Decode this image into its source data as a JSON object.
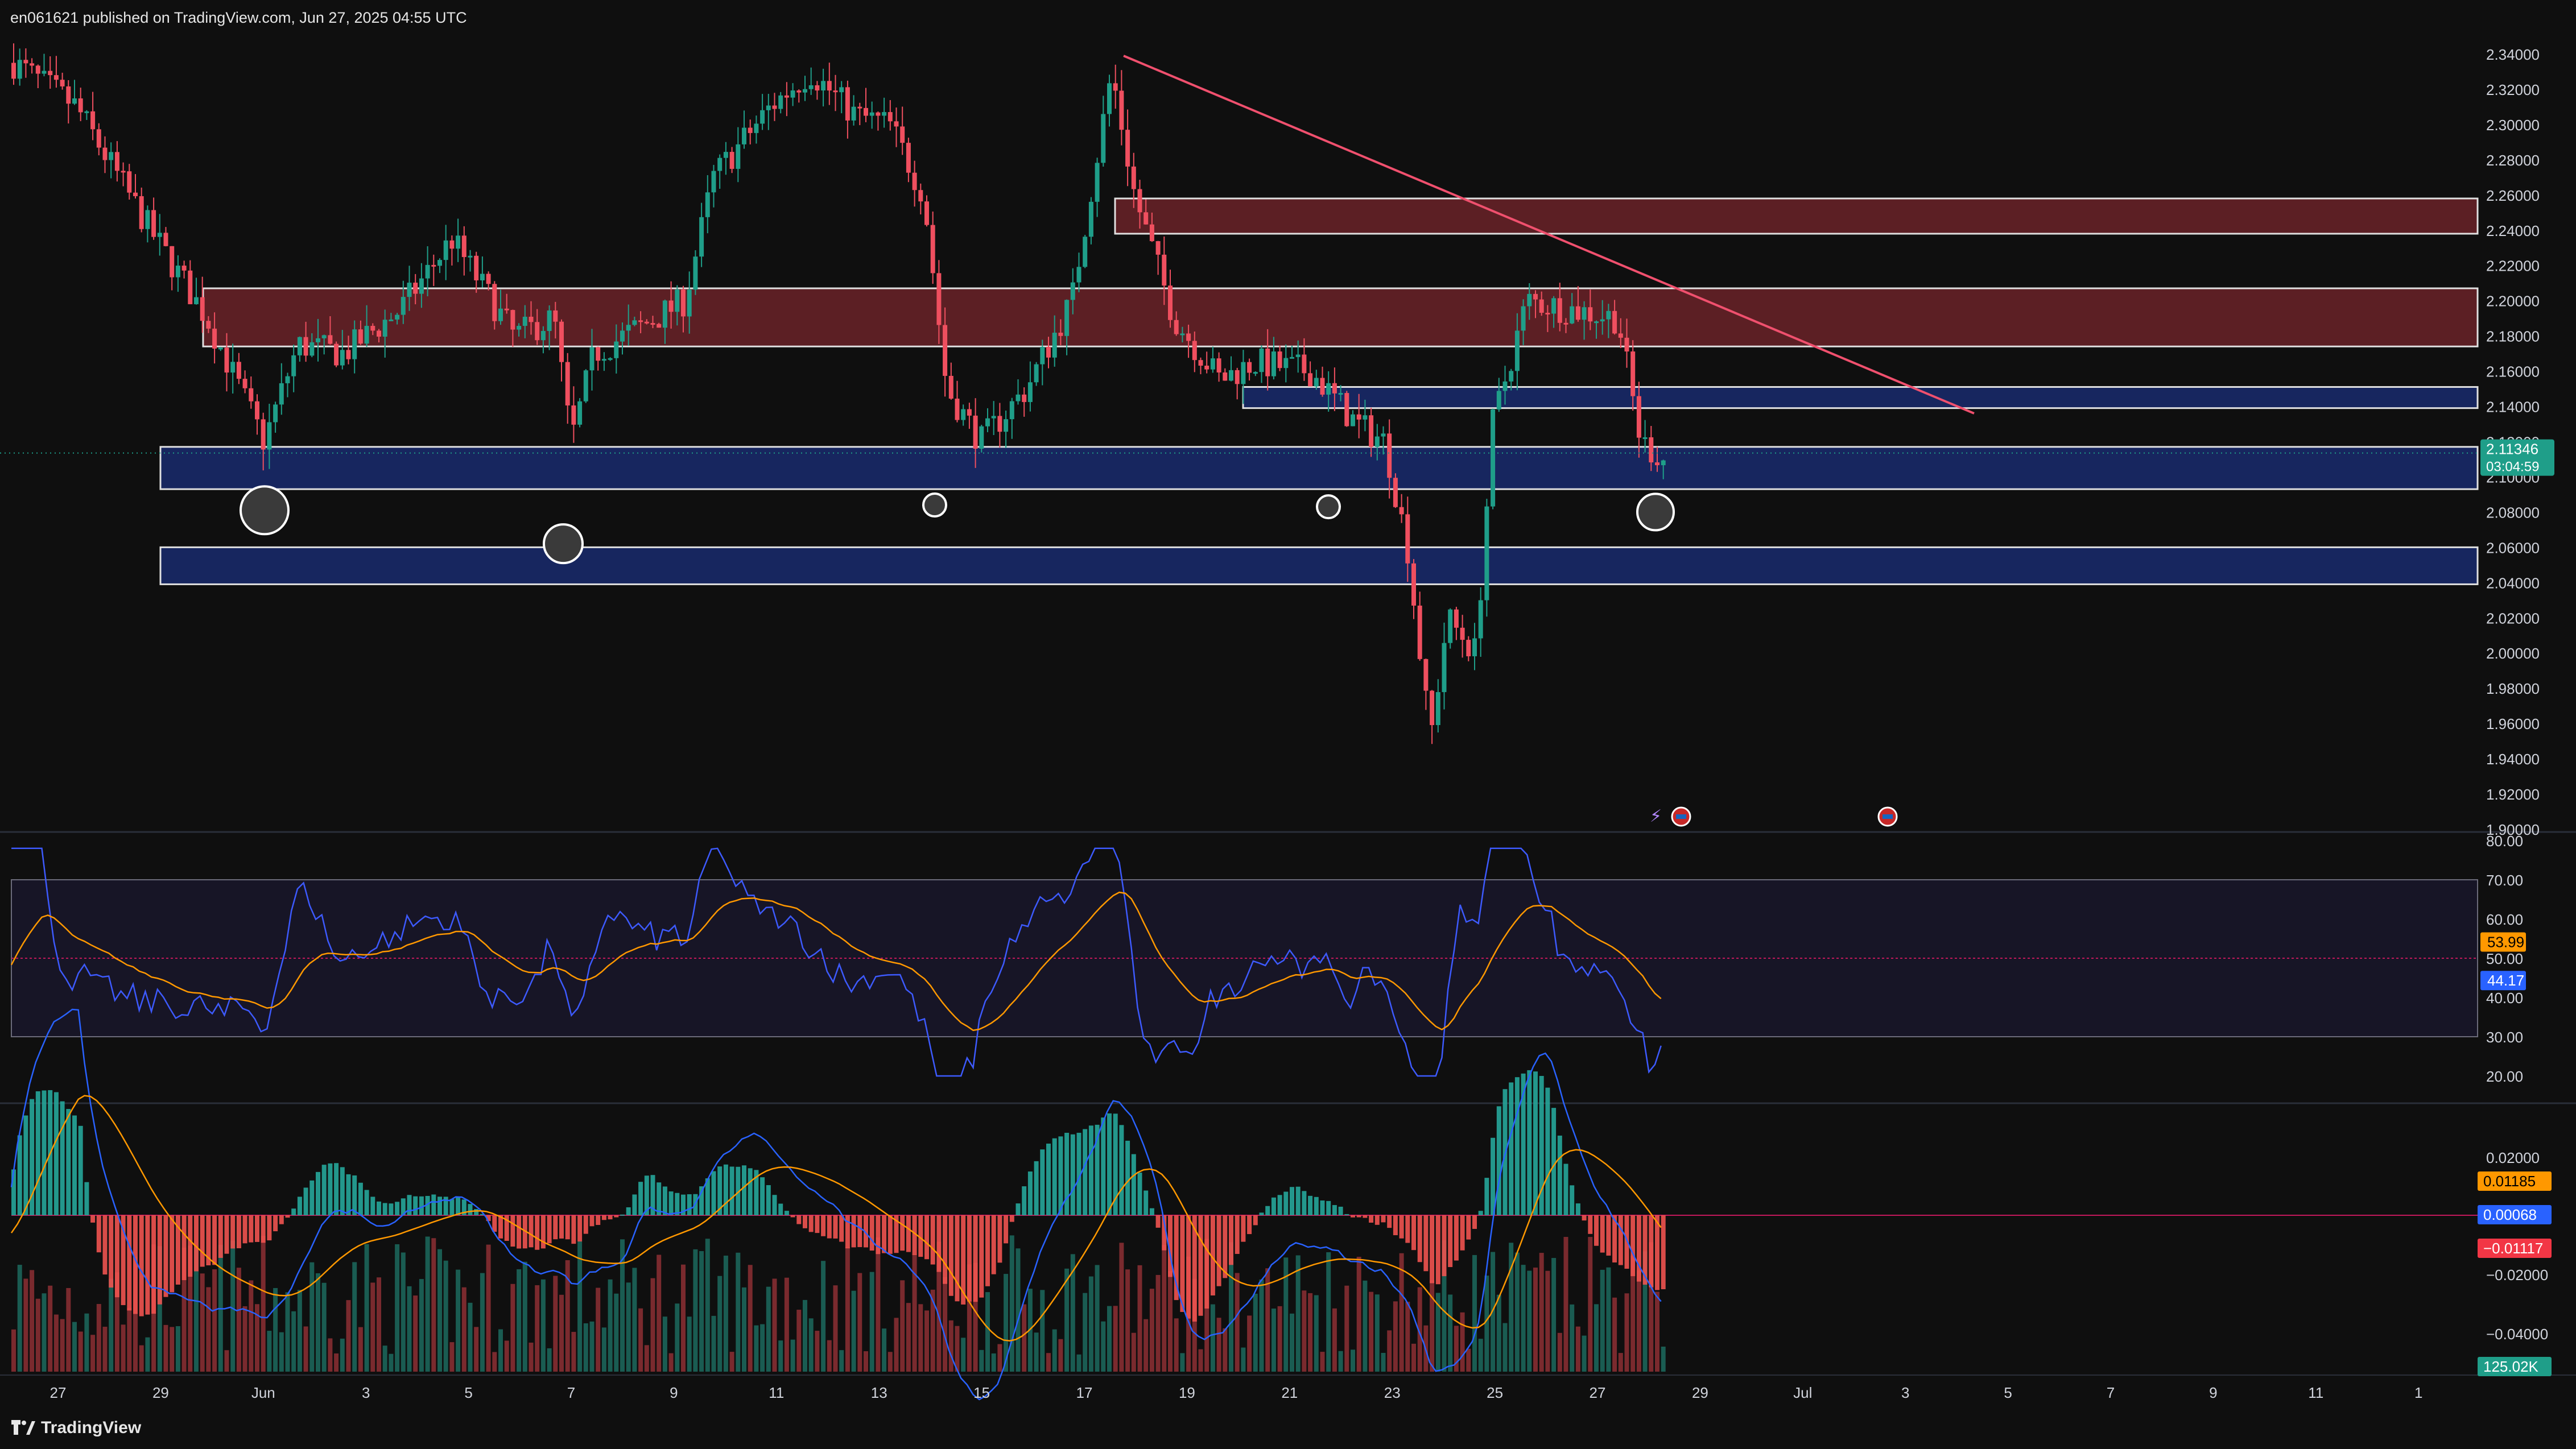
{
  "header": {
    "published_text": "en061621 published on TradingView.com, Jun 27, 2025 04:55 UTC"
  },
  "footer": {
    "brand": "TradingView"
  },
  "icons": [
    "tradingview-logo-icon",
    "flash-icon",
    "us-flag-event-icon"
  ],
  "colors": {
    "background": "#0f0f0f",
    "up_candle": "#1f9e89",
    "down_candle": "#ef4f5f",
    "resistance_zone": "#5c1f24",
    "support_zone": "#17265f",
    "trendline": "#f0506e",
    "rsi_line": "#3d5afe",
    "rsi_ma": "#ff9800",
    "macd_line": "#2962ff",
    "signal_line": "#ff9800",
    "volume_up": "#1a5c52",
    "volume_down": "#7a2a2e",
    "price_label": "#1f9e89",
    "rsi_ma_label": "#ff9800",
    "rsi_label": "#2962ff",
    "macd_hist_label": "#f23645"
  },
  "price_axis": {
    "ticks": [
      "2.34000",
      "2.32000",
      "2.30000",
      "2.28000",
      "2.26000",
      "2.24000",
      "2.22000",
      "2.20000",
      "2.18000",
      "2.16000",
      "2.14000",
      "2.12000",
      "2.10000",
      "2.08000",
      "2.06000",
      "2.04000",
      "2.02000",
      "2.00000",
      "1.98000",
      "1.96000",
      "1.94000",
      "1.92000",
      "1.90000"
    ],
    "current_price": "2.11346",
    "countdown": "03:04:59"
  },
  "rsi_axis": {
    "ticks": [
      "80.00",
      "70.00",
      "60.00",
      "50.00",
      "40.00",
      "30.00",
      "20.00"
    ],
    "rsi_ma_value": "53.99",
    "rsi_value": "44.17"
  },
  "macd_axis": {
    "ticks": [
      "0.02000",
      "0.00000",
      "−0.02000",
      "−0.04000"
    ],
    "macd_value": "0.01185",
    "signal_value": "0.00068",
    "histogram_value": "−0.01117",
    "volume_value": "125.02K"
  },
  "time_axis": {
    "labels": [
      "27",
      "29",
      "Jun",
      "3",
      "5",
      "7",
      "9",
      "11",
      "13",
      "15",
      "17",
      "19",
      "21",
      "23",
      "25",
      "27",
      "29",
      "Jul",
      "3",
      "5",
      "7",
      "9",
      "11",
      "1"
    ]
  },
  "chart_data": {
    "type": "candlestick",
    "price_range": [
      1.9,
      2.34
    ],
    "zones": [
      {
        "kind": "resistance",
        "low": 2.238,
        "high": 2.258
      },
      {
        "kind": "resistance",
        "low": 2.174,
        "high": 2.207
      },
      {
        "kind": "support",
        "low": 2.139,
        "high": 2.151
      },
      {
        "kind": "support",
        "low": 2.093,
        "high": 2.117
      },
      {
        "kind": "support",
        "low": 2.039,
        "high": 2.06
      }
    ],
    "trendline": {
      "from_price": 2.339,
      "to_price": 2.136
    },
    "rsi": {
      "range": [
        20,
        80
      ],
      "band": [
        30,
        70
      ],
      "mid": 50
    },
    "macd": {
      "range": [
        -0.045,
        0.025
      ]
    }
  }
}
